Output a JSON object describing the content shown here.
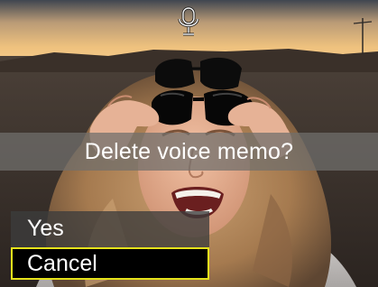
{
  "dialog": {
    "title": "Delete voice memo?"
  },
  "menu": {
    "items": [
      {
        "label": "Yes",
        "selected": false
      },
      {
        "label": "Cancel",
        "selected": true
      }
    ],
    "highlight_color": "#e5e21b"
  },
  "status": {
    "icon": "microphone-icon"
  },
  "photo": {
    "subject": "woman with sunglasses on head",
    "sky_color": "#efc27e",
    "hair_color": "#b2865a"
  }
}
